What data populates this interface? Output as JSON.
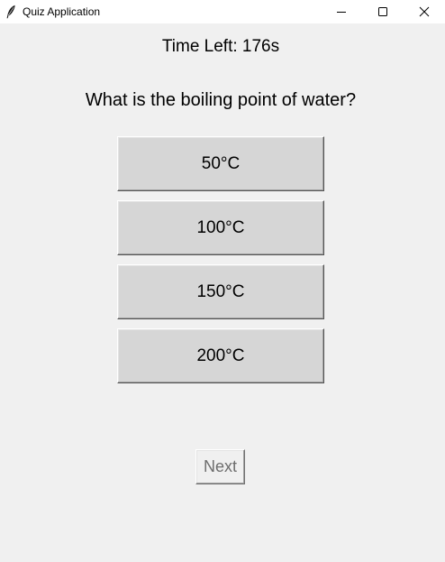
{
  "window": {
    "title": "Quiz Application",
    "icon": "feather-icon",
    "controls": {
      "minimize": "minimize-icon",
      "maximize": "maximize-icon",
      "close": "close-icon"
    }
  },
  "quiz": {
    "timer_text": "Time Left: 176s",
    "question": "What is the boiling point of water?",
    "answers": [
      {
        "label": "50°C"
      },
      {
        "label": "100°C"
      },
      {
        "label": "150°C"
      },
      {
        "label": "200°C"
      }
    ],
    "next_label": "Next",
    "next_enabled": false
  },
  "colors": {
    "background": "#f0f0f0",
    "button_face": "#d6d6d6",
    "disabled_text": "#6d6d6d",
    "titlebar": "#ffffff"
  }
}
